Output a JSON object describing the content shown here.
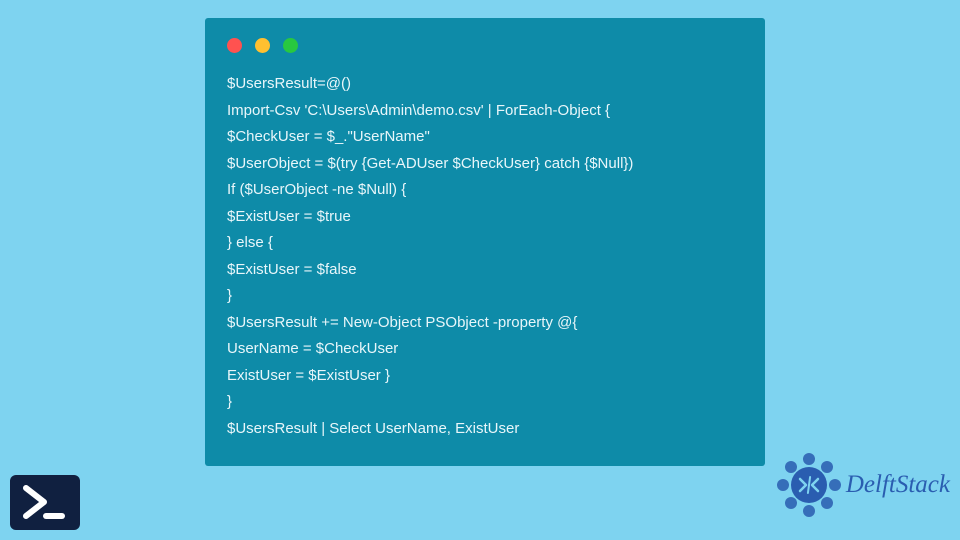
{
  "code_lines": [
    "$UsersResult=@()",
    "Import-Csv 'C:\\Users\\Admin\\demo.csv' | ForEach-Object {",
    "$CheckUser = $_.\"UserName\"",
    "$UserObject = $(try {Get-ADUser $CheckUser} catch {$Null})",
    "If ($UserObject -ne $Null) {",
    "$ExistUser = $true",
    "} else {",
    "$ExistUser = $false",
    "}",
    "$UsersResult += New-Object PSObject -property @{",
    "UserName = $CheckUser",
    "ExistUser = $ExistUser }",
    "}",
    "$UsersResult | Select UserName, ExistUser"
  ],
  "brand": {
    "name": "DelftStack"
  },
  "colors": {
    "background": "#7ed3f0",
    "codebox": "#0e8ba8",
    "codetext": "#e8f6fa",
    "brand": "#2a5db0"
  }
}
